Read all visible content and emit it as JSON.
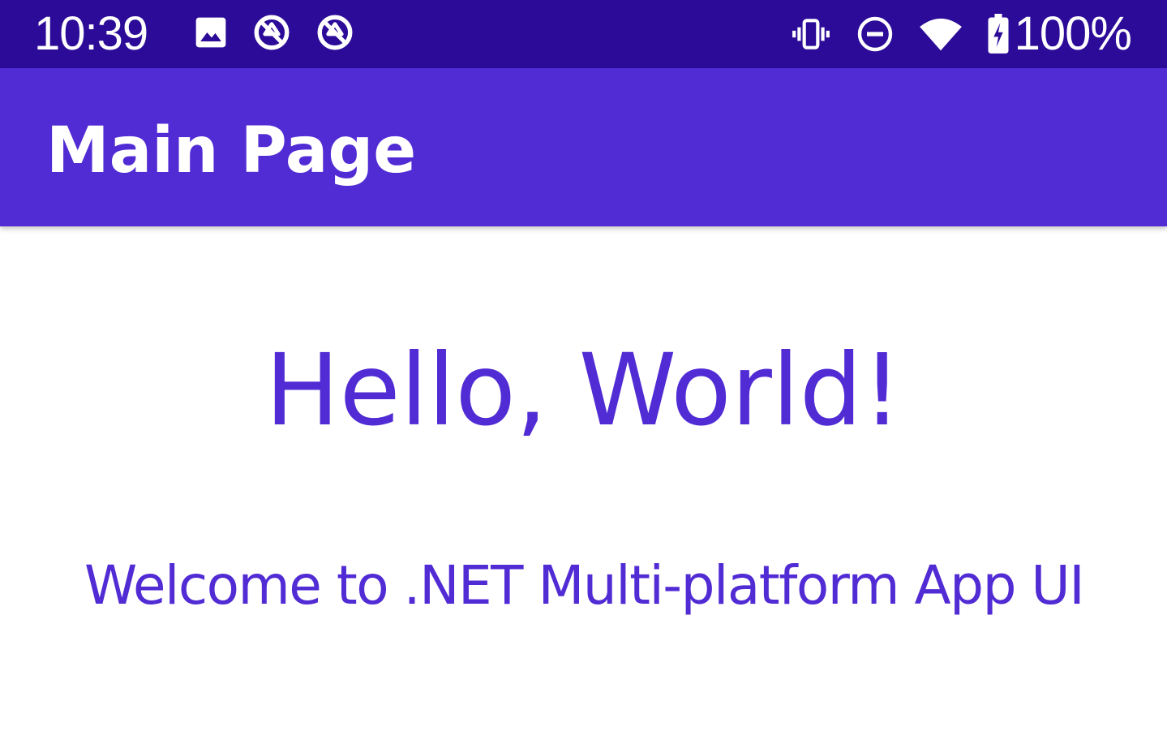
{
  "status_bar": {
    "time": "10:39",
    "left_icons": [
      "image-icon",
      "data-saver-icon",
      "data-saver-icon"
    ],
    "right_icons": [
      "vibrate-icon",
      "do-not-disturb-icon",
      "wifi-icon",
      "battery-charging-icon"
    ],
    "battery_percent": "100%",
    "background_color": "#2b0b98"
  },
  "app_bar": {
    "title": "Main Page",
    "background_color": "#512bd4"
  },
  "main": {
    "heading": "Hello, World!",
    "subheading": "Welcome to .NET Multi-platform App UI",
    "text_color": "#512bd4"
  }
}
